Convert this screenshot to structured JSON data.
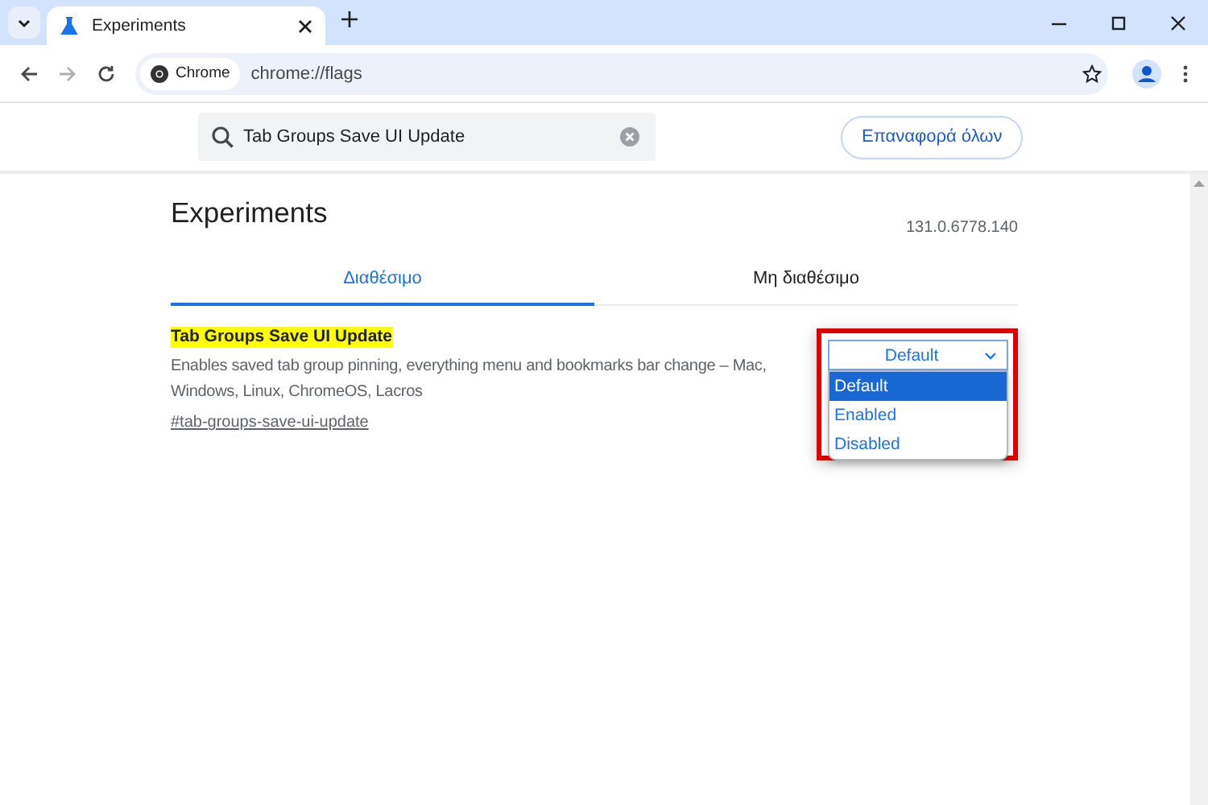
{
  "browser_tab": {
    "title": "Experiments",
    "selected": true
  },
  "address_bar": {
    "site_chip": "Chrome",
    "url": "chrome://flags"
  },
  "search": {
    "value": "Tab Groups Save UI Update"
  },
  "reset_button": "Επαναφορά όλων",
  "page": {
    "title": "Experiments",
    "version": "131.0.6778.140"
  },
  "tabs": [
    {
      "label": "Διαθέσιμο",
      "selected": true
    },
    {
      "label": "Μη διαθέσιμο",
      "selected": false
    }
  ],
  "flags": [
    {
      "name": "Tab Groups Save UI Update",
      "description": "Enables saved tab group pinning, everything menu and bookmarks bar change – Mac, Windows, Linux, ChromeOS, Lacros",
      "link": "#tab-groups-save-ui-update",
      "value": "Default",
      "expanded": true,
      "highlighted": true,
      "options": [
        {
          "label": "Default",
          "selected": true
        },
        {
          "label": "Enabled",
          "selected": false
        },
        {
          "label": "Disabled",
          "selected": false
        }
      ]
    }
  ]
}
